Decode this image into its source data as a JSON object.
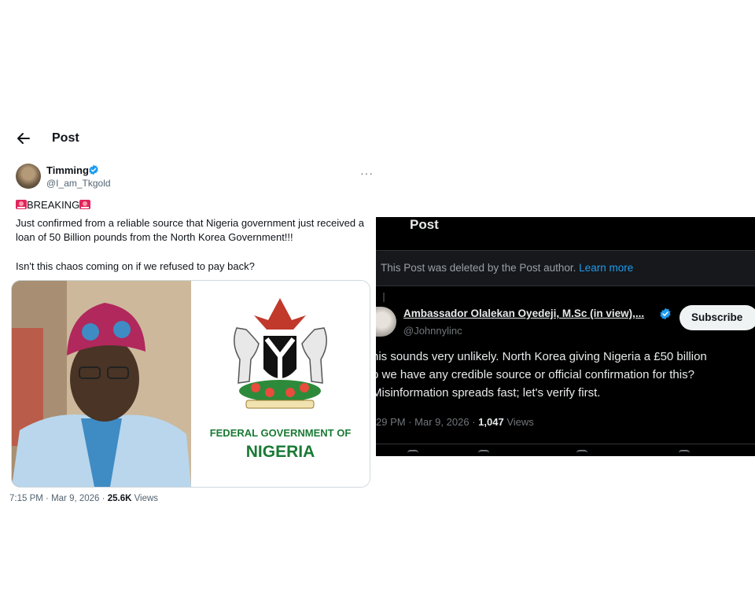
{
  "left_post": {
    "header_title": "Post",
    "author_name": "Timming",
    "author_handle": "@I_am_Tkgold",
    "more_glyph": "···",
    "breaking_label": "BREAKING",
    "body_text": "Just confirmed from a reliable source that Nigeria government just received a loan of 50 Billion pounds from the North Korea Government!!!",
    "question_text": "Isn't this chaos coming on if we refused to pay back?",
    "media": {
      "emblem_line1": "FEDERAL GOVERNMENT OF",
      "emblem_line2": "NIGERIA"
    },
    "time": "7:15 PM",
    "date": "Mar 9, 2026",
    "views_count": "25.6K",
    "views_label": "Views",
    "separator": "·"
  },
  "right_post": {
    "header_title": "Post",
    "deleted_notice": "This Post was deleted by the Post author.",
    "learn_more": "Learn more",
    "author_name": "Ambassador Olalekan Oyedeji, M.Sc (in view),...",
    "author_handle": "@Johnnylinc",
    "subscribe_label": "Subscribe",
    "reply_lines": [
      "his sounds very unlikely. North Korea giving Nigeria a £50 billion",
      "o we have any credible source or official confirmation for this?",
      "Misinformation spreads fast; let's verify first."
    ],
    "time": "29 PM",
    "date": "Mar 9, 2026",
    "views_count": "1,047",
    "views_label": "Views",
    "separator": "·"
  },
  "colors": {
    "accent_blue": "#1d9bf0",
    "verified_badge": "#1d9bf0",
    "emblem_green": "#1a7a34",
    "siren_red": "#e0245e",
    "dark_bg": "#000000",
    "banner_bg": "#16181c"
  },
  "icons": {
    "back": "arrow-left-icon",
    "verified": "verified-badge-icon",
    "siren": "police-light-emoji",
    "more": "more-horizontal-icon"
  }
}
